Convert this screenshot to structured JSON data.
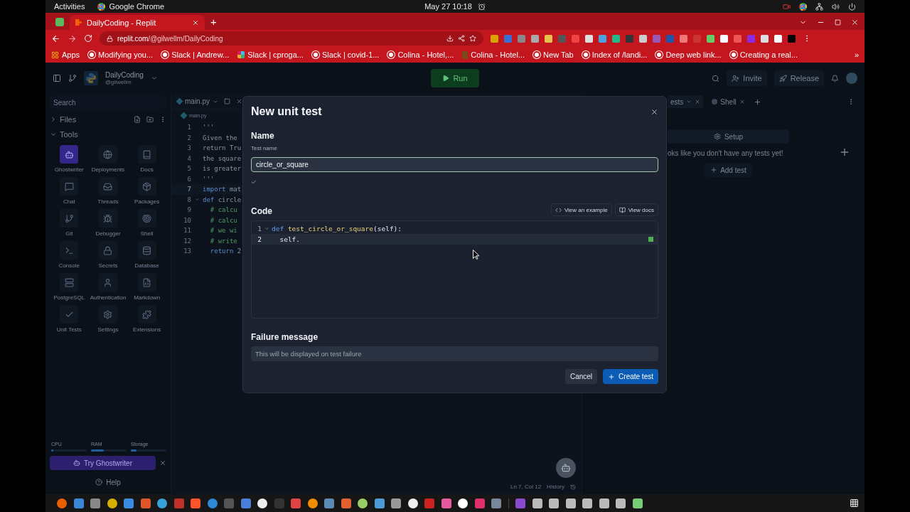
{
  "system_bar": {
    "activities": "Activities",
    "app": "Google Chrome",
    "clock": "May 27  10:18"
  },
  "browser": {
    "tabs": [
      {
        "title": "DailyCoding - Replit",
        "selected": true
      }
    ],
    "new_tab": "+",
    "url_host": "replit.com",
    "url_path": "/@gilwellm/DailyCoding",
    "bookmarks": [
      {
        "label": "Apps",
        "kind": "apps"
      },
      {
        "label": "Modifying you...",
        "kind": "site"
      },
      {
        "label": "Slack | Andrew...",
        "kind": "site"
      },
      {
        "label": "Slack | cproga...",
        "kind": "slack"
      },
      {
        "label": "Slack | covid-1...",
        "kind": "site"
      },
      {
        "label": "Colina - Hotel,...",
        "kind": "site"
      },
      {
        "label": "Colina - Hotel...",
        "kind": "page"
      },
      {
        "label": "New Tab",
        "kind": "site"
      },
      {
        "label": "Index of /landi...",
        "kind": "site"
      },
      {
        "label": "Deep web link...",
        "kind": "site"
      },
      {
        "label": "Creating a real...",
        "kind": "site"
      }
    ],
    "more_bookmarks": "»"
  },
  "replit": {
    "header": {
      "repl_name": "DailyCoding",
      "owner": "@gilwellm",
      "run": "Run",
      "invite": "Invite",
      "release": "Release"
    },
    "sidebar": {
      "search_placeholder": "Search",
      "files": "Files",
      "tools_title": "Tools",
      "tools": [
        {
          "label": "Ghostwriter",
          "selected": true
        },
        {
          "label": "Deployments",
          "selected": false
        },
        {
          "label": "Docs",
          "selected": false
        },
        {
          "label": "Chat",
          "selected": false
        },
        {
          "label": "Threads",
          "selected": false
        },
        {
          "label": "Packages",
          "selected": false
        },
        {
          "label": "Git",
          "selected": false
        },
        {
          "label": "Debugger",
          "selected": false
        },
        {
          "label": "Shell",
          "selected": false
        },
        {
          "label": "Console",
          "selected": false
        },
        {
          "label": "Secrets",
          "selected": false
        },
        {
          "label": "Database",
          "selected": false
        },
        {
          "label": "PostgreSQL",
          "selected": false
        },
        {
          "label": "Authentication",
          "selected": false
        },
        {
          "label": "Markdown",
          "selected": false
        },
        {
          "label": "Unit Tests",
          "selected": false
        },
        {
          "label": "Settings",
          "selected": false
        },
        {
          "label": "Extensions",
          "selected": false
        }
      ],
      "resources": [
        {
          "label": "CPU",
          "level": 0.05
        },
        {
          "label": "RAM",
          "level": 0.35
        },
        {
          "label": "Storage",
          "level": 0.15
        }
      ],
      "ghostwriter_button": "Try Ghostwriter",
      "help": "Help"
    },
    "editor": {
      "tab": "main.py",
      "breadcrumb": "main.py",
      "lines": [
        {
          "number": "1",
          "active": false,
          "foldable": false,
          "tokens": [
            {
              "kind": "string",
              "text": "'''"
            }
          ]
        },
        {
          "number": "2",
          "active": false,
          "foldable": false,
          "tokens": [
            {
              "kind": "string",
              "text": "Given the"
            }
          ]
        },
        {
          "number": "3",
          "active": false,
          "foldable": false,
          "tokens": [
            {
              "kind": "string",
              "text": "return Tru"
            }
          ]
        },
        {
          "number": "4",
          "active": false,
          "foldable": false,
          "tokens": [
            {
              "kind": "string",
              "text": "the square"
            }
          ]
        },
        {
          "number": "5",
          "active": false,
          "foldable": false,
          "tokens": [
            {
              "kind": "string",
              "text": "is greater"
            }
          ]
        },
        {
          "number": "6",
          "active": false,
          "foldable": false,
          "tokens": [
            {
              "kind": "string",
              "text": "'''"
            }
          ]
        },
        {
          "number": "7",
          "active": true,
          "foldable": false,
          "tokens": [
            {
              "kind": "keyword",
              "text": "import"
            },
            {
              "kind": "plain",
              "text": " mat"
            }
          ]
        },
        {
          "number": "8",
          "active": false,
          "foldable": true,
          "tokens": [
            {
              "kind": "keyword",
              "text": "def"
            },
            {
              "kind": "plain",
              "text": " circle"
            }
          ]
        },
        {
          "number": "9",
          "active": false,
          "foldable": false,
          "tokens": [
            {
              "kind": "comment",
              "text": "  # calcu"
            }
          ]
        },
        {
          "number": "10",
          "active": false,
          "foldable": false,
          "tokens": [
            {
              "kind": "comment",
              "text": "  # calcu"
            }
          ]
        },
        {
          "number": "11",
          "active": false,
          "foldable": false,
          "tokens": [
            {
              "kind": "comment",
              "text": "  # we wi"
            }
          ]
        },
        {
          "number": "12",
          "active": false,
          "foldable": false,
          "tokens": [
            {
              "kind": "comment",
              "text": "  # write"
            }
          ]
        },
        {
          "number": "13",
          "active": false,
          "foldable": false,
          "tokens": [
            {
              "kind": "keyword",
              "text": "  return"
            },
            {
              "kind": "plain",
              "text": " 2"
            }
          ]
        }
      ],
      "cursor_position": "Ln 7, Col 12",
      "history": "History"
    },
    "tests_panel": {
      "tabs": [
        {
          "label": "ests",
          "selected": true
        },
        {
          "label": "Shell",
          "selected": false
        }
      ],
      "setup": "Setup",
      "empty_message": "oks like you don't have any tests yet!",
      "add_test": "Add test"
    }
  },
  "dialog": {
    "title": "New unit test",
    "name_heading": "Name",
    "name_label": "Test name",
    "name_value": "circle_or_square",
    "valid": true,
    "code_heading": "Code",
    "view_example": "View an example",
    "view_docs": "View docs",
    "code_lines": [
      {
        "number": "1",
        "active": false,
        "foldable": true,
        "tokens": [
          {
            "kind": "keyword",
            "text": "def "
          },
          {
            "kind": "function",
            "text": "test_circle_or_square"
          },
          {
            "kind": "plain",
            "text": "(self):"
          }
        ]
      },
      {
        "number": "2",
        "active": true,
        "foldable": false,
        "tokens": [
          {
            "kind": "plain",
            "text": "  self."
          }
        ]
      }
    ],
    "failure_heading": "Failure message",
    "failure_placeholder": "This will be displayed on test failure",
    "cancel": "Cancel",
    "create": "Create test"
  }
}
